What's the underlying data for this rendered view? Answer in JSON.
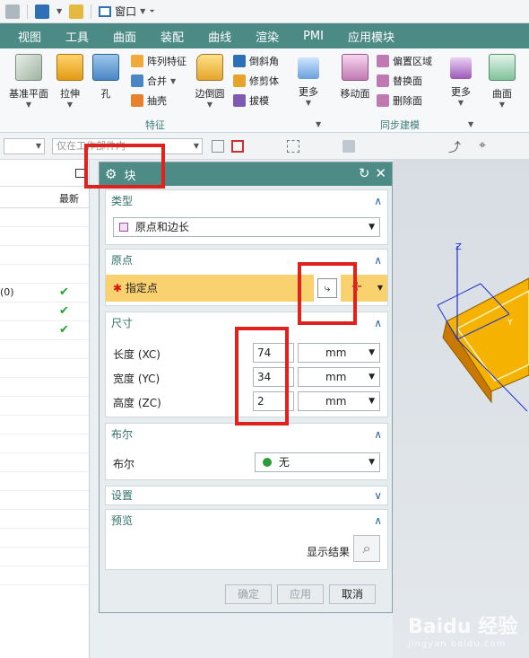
{
  "menu": [
    "视图",
    "工具",
    "曲面",
    "装配",
    "曲线",
    "渲染",
    "PMI",
    "应用模块"
  ],
  "quick_access": {
    "window_label": "窗口"
  },
  "ribbon": {
    "datum_plane": "基准平面",
    "extrude": "拉伸",
    "hole": "孔",
    "pattern_feature": "阵列特征",
    "unite": "合并",
    "shell": "抽壳",
    "edge_blend": "边倒圆",
    "chamfer": "倒斜角",
    "trim_body": "修剪体",
    "draft": "拔模",
    "more": "更多",
    "move_face": "移动面",
    "offset_region": "偏置区域",
    "replace_face": "替换面",
    "delete_face": "删除面",
    "more2": "更多",
    "surface": "曲面",
    "group_feature": "特征",
    "group_sync": "同步建模"
  },
  "toolbar2": {
    "filter_placeholder": "仅在工作部件内"
  },
  "nav": {
    "col_latest": "最新",
    "row_text": "(0)"
  },
  "dialog": {
    "title": "块",
    "type_label": "类型",
    "type_value": "原点和边长",
    "origin_label": "原点",
    "specify_point": "指定点",
    "dimensions_label": "尺寸",
    "length_label": "长度 (XC)",
    "length_value": "74",
    "width_label": "宽度 (YC)",
    "width_value": "34",
    "height_label": "高度 (ZC)",
    "height_value": "2",
    "unit": "mm",
    "boolean_section": "布尔",
    "boolean_label": "布尔",
    "boolean_value": "无",
    "settings_label": "设置",
    "preview_label": "预览",
    "show_result": "显示结果",
    "ok": "确定",
    "apply": "应用",
    "cancel": "取消"
  },
  "watermark": {
    "brand": "Baidu 经验",
    "sub": "jingyan.baidu.com"
  },
  "colors": {
    "accent": "#4d8b87",
    "highlight": "#f9d26f",
    "part_face": "#f5b300",
    "annotation": "#e0221e"
  }
}
